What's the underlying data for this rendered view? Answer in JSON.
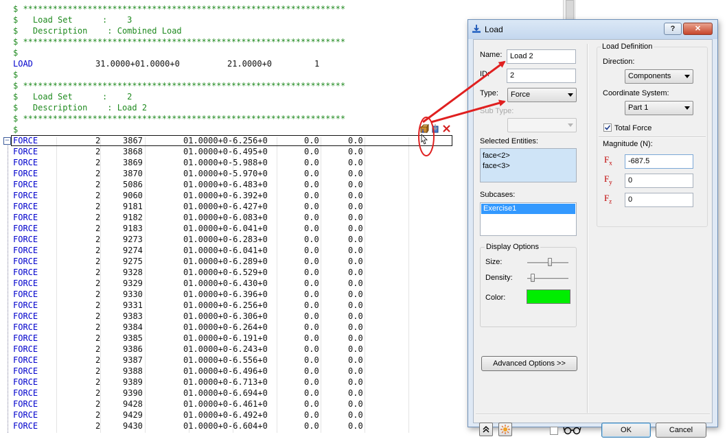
{
  "editor": {
    "header_lines": [
      {
        "type": "comment",
        "text": "$ *****************************************************************"
      },
      {
        "type": "comment",
        "text": "$   Load Set      :    3"
      },
      {
        "type": "comment",
        "text": "$   Description    : Combined Load"
      },
      {
        "type": "comment",
        "text": "$ *****************************************************************"
      },
      {
        "type": "comment",
        "text": "$"
      },
      {
        "type": "load",
        "keyword": "LOAD",
        "c1": "31.0000+01.0000+0",
        "c2": "21.0000+0",
        "c3": "1"
      },
      {
        "type": "comment",
        "text": "$"
      },
      {
        "type": "comment",
        "text": "$ *****************************************************************"
      },
      {
        "type": "comment",
        "text": "$   Load Set      :    2"
      },
      {
        "type": "comment",
        "text": "$   Description    : Load 2"
      },
      {
        "type": "comment",
        "text": "$ *****************************************************************"
      },
      {
        "type": "comment",
        "text": "$"
      }
    ],
    "force_keyword": "FORCE",
    "force_rows": [
      {
        "sid": "2",
        "node": "3867",
        "vals": "01.0000+0-6.256+0",
        "c4": "0.0",
        "c5": "0.0"
      },
      {
        "sid": "2",
        "node": "3868",
        "vals": "01.0000+0-6.495+0",
        "c4": "0.0",
        "c5": "0.0"
      },
      {
        "sid": "2",
        "node": "3869",
        "vals": "01.0000+0-5.988+0",
        "c4": "0.0",
        "c5": "0.0"
      },
      {
        "sid": "2",
        "node": "3870",
        "vals": "01.0000+0-5.970+0",
        "c4": "0.0",
        "c5": "0.0"
      },
      {
        "sid": "2",
        "node": "5086",
        "vals": "01.0000+0-6.483+0",
        "c4": "0.0",
        "c5": "0.0"
      },
      {
        "sid": "2",
        "node": "9060",
        "vals": "01.0000+0-6.392+0",
        "c4": "0.0",
        "c5": "0.0"
      },
      {
        "sid": "2",
        "node": "9181",
        "vals": "01.0000+0-6.427+0",
        "c4": "0.0",
        "c5": "0.0"
      },
      {
        "sid": "2",
        "node": "9182",
        "vals": "01.0000+0-6.083+0",
        "c4": "0.0",
        "c5": "0.0"
      },
      {
        "sid": "2",
        "node": "9183",
        "vals": "01.0000+0-6.041+0",
        "c4": "0.0",
        "c5": "0.0"
      },
      {
        "sid": "2",
        "node": "9273",
        "vals": "01.0000+0-6.283+0",
        "c4": "0.0",
        "c5": "0.0"
      },
      {
        "sid": "2",
        "node": "9274",
        "vals": "01.0000+0-6.041+0",
        "c4": "0.0",
        "c5": "0.0"
      },
      {
        "sid": "2",
        "node": "9275",
        "vals": "01.0000+0-6.289+0",
        "c4": "0.0",
        "c5": "0.0"
      },
      {
        "sid": "2",
        "node": "9328",
        "vals": "01.0000+0-6.529+0",
        "c4": "0.0",
        "c5": "0.0"
      },
      {
        "sid": "2",
        "node": "9329",
        "vals": "01.0000+0-6.430+0",
        "c4": "0.0",
        "c5": "0.0"
      },
      {
        "sid": "2",
        "node": "9330",
        "vals": "01.0000+0-6.396+0",
        "c4": "0.0",
        "c5": "0.0"
      },
      {
        "sid": "2",
        "node": "9331",
        "vals": "01.0000+0-6.256+0",
        "c4": "0.0",
        "c5": "0.0"
      },
      {
        "sid": "2",
        "node": "9383",
        "vals": "01.0000+0-6.306+0",
        "c4": "0.0",
        "c5": "0.0"
      },
      {
        "sid": "2",
        "node": "9384",
        "vals": "01.0000+0-6.264+0",
        "c4": "0.0",
        "c5": "0.0"
      },
      {
        "sid": "2",
        "node": "9385",
        "vals": "01.0000+0-6.191+0",
        "c4": "0.0",
        "c5": "0.0"
      },
      {
        "sid": "2",
        "node": "9386",
        "vals": "01.0000+0-6.243+0",
        "c4": "0.0",
        "c5": "0.0"
      },
      {
        "sid": "2",
        "node": "9387",
        "vals": "01.0000+0-6.556+0",
        "c4": "0.0",
        "c5": "0.0"
      },
      {
        "sid": "2",
        "node": "9388",
        "vals": "01.0000+0-6.496+0",
        "c4": "0.0",
        "c5": "0.0"
      },
      {
        "sid": "2",
        "node": "9389",
        "vals": "01.0000+0-6.713+0",
        "c4": "0.0",
        "c5": "0.0"
      },
      {
        "sid": "2",
        "node": "9390",
        "vals": "01.0000+0-6.694+0",
        "c4": "0.0",
        "c5": "0.0"
      },
      {
        "sid": "2",
        "node": "9428",
        "vals": "01.0000+0-6.461+0",
        "c4": "0.0",
        "c5": "0.0"
      },
      {
        "sid": "2",
        "node": "9429",
        "vals": "01.0000+0-6.492+0",
        "c4": "0.0",
        "c5": "0.0"
      },
      {
        "sid": "2",
        "node": "9430",
        "vals": "01.0000+0-6.604+0",
        "c4": "0.0",
        "c5": "0.0"
      }
    ],
    "line_icons": [
      "edit-load-icon",
      "load-icon",
      "delete-icon"
    ],
    "colors": {
      "comment": "#1f8a1f",
      "keyword": "#0000cc",
      "delete": "#d42020",
      "annotation": "#e02020"
    }
  },
  "dialog": {
    "title": "Load",
    "help_label": "?",
    "close_label": "✕",
    "name_label": "Name:",
    "name_value": "Load 2",
    "id_label": "ID:",
    "id_value": "2",
    "type_label": "Type:",
    "type_value": "Force",
    "subtype_label": "Sub Type:",
    "subtype_value": "",
    "selected_entities_label": "Selected Entities:",
    "selected_entities": [
      "face<2>",
      "face<3>"
    ],
    "subcases_label": "Subcases:",
    "subcases": [
      "Exercise1"
    ],
    "display_options": {
      "title": "Display Options",
      "size_label": "Size:",
      "size_value": 0.55,
      "density_label": "Density:",
      "density_value": 0.1,
      "color_label": "Color:",
      "color_value": "#00ee00"
    },
    "advanced_label": "Advanced Options >>",
    "load_definition": {
      "title": "Load Definition",
      "direction_label": "Direction:",
      "direction_value": "Components",
      "coord_label": "Coordinate System:",
      "coord_value": "Part 1",
      "total_force_label": "Total Force",
      "total_force_checked": true,
      "magnitude_label": "Magnitude (N):",
      "fx_label": "F",
      "fx_sub": "x",
      "fx_value": "-687.5",
      "fy_label": "F",
      "fy_sub": "y",
      "fy_value": "0",
      "fz_label": "F",
      "fz_sub": "z",
      "fz_value": "0"
    },
    "ok_label": "OK",
    "cancel_label": "Cancel"
  }
}
